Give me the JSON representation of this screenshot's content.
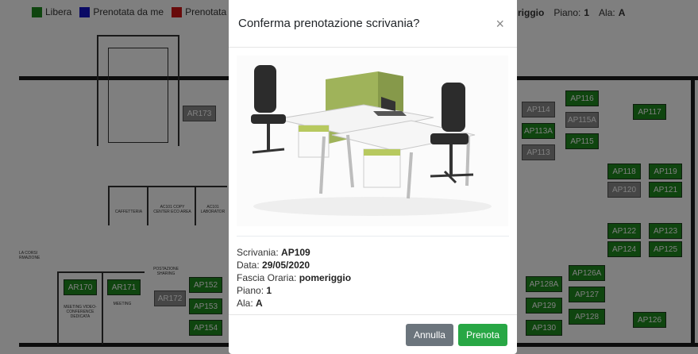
{
  "legend": {
    "free": {
      "label": "Libera",
      "color": "#1f8a1f"
    },
    "mine": {
      "label": "Prenotata da me",
      "color": "#1414c8"
    },
    "taken": {
      "label": "Prenotata",
      "color": "#d01414"
    }
  },
  "header_info": {
    "slot_value": "riggio",
    "floor_label": "Piano:",
    "floor_value": "1",
    "wing_label": "Ala:",
    "wing_value": "A"
  },
  "floorplan": {
    "rooms_left": [
      "AR173",
      "AR170",
      "AR171",
      "AR172"
    ],
    "desks_left": [
      "AP152",
      "AP153",
      "AP154"
    ],
    "labels_left": {
      "caffetteria": "CAFFETTERIA",
      "ac101": "AC101 COPY CENTER ECO AREA",
      "ac101b": "AC101 LABORATOR",
      "corsi": "LA CORSI RMAZIONE",
      "postazione": "POSTAZIONE SHARING",
      "meeting_video": "MEETING VIDEO- CONFERENCE DEDICATA",
      "meeting": "MEETING"
    },
    "desks_right": {
      "ap116": "AP116",
      "ap114": "AP114",
      "ap115a": "AP115A",
      "ap113a": "AP113A",
      "ap115": "AP115",
      "ap113": "AP113",
      "ap117": "AP117",
      "ap118": "AP118",
      "ap119": "AP119",
      "ap120": "AP120",
      "ap121": "AP121",
      "ap122": "AP122",
      "ap123": "AP123",
      "ap124": "AP124",
      "ap125": "AP125",
      "ap126a": "AP126A",
      "ap128a": "AP128A",
      "ap127": "AP127",
      "ap129": "AP129",
      "ap128": "AP128",
      "ap130": "AP130",
      "ap126": "AP126"
    }
  },
  "modal": {
    "title": "Conferma prenotazione scrivania?",
    "close": "×",
    "details": {
      "desk_label": "Scrivania:",
      "desk_value": "AP109",
      "date_label": "Data:",
      "date_value": "29/05/2020",
      "slot_label": "Fascia Oraria:",
      "slot_value": "pomeriggio",
      "floor_label": "Piano:",
      "floor_value": "1",
      "wing_label": "Ala:",
      "wing_value": "A"
    },
    "buttons": {
      "cancel": "Annulla",
      "confirm": "Prenota"
    }
  }
}
